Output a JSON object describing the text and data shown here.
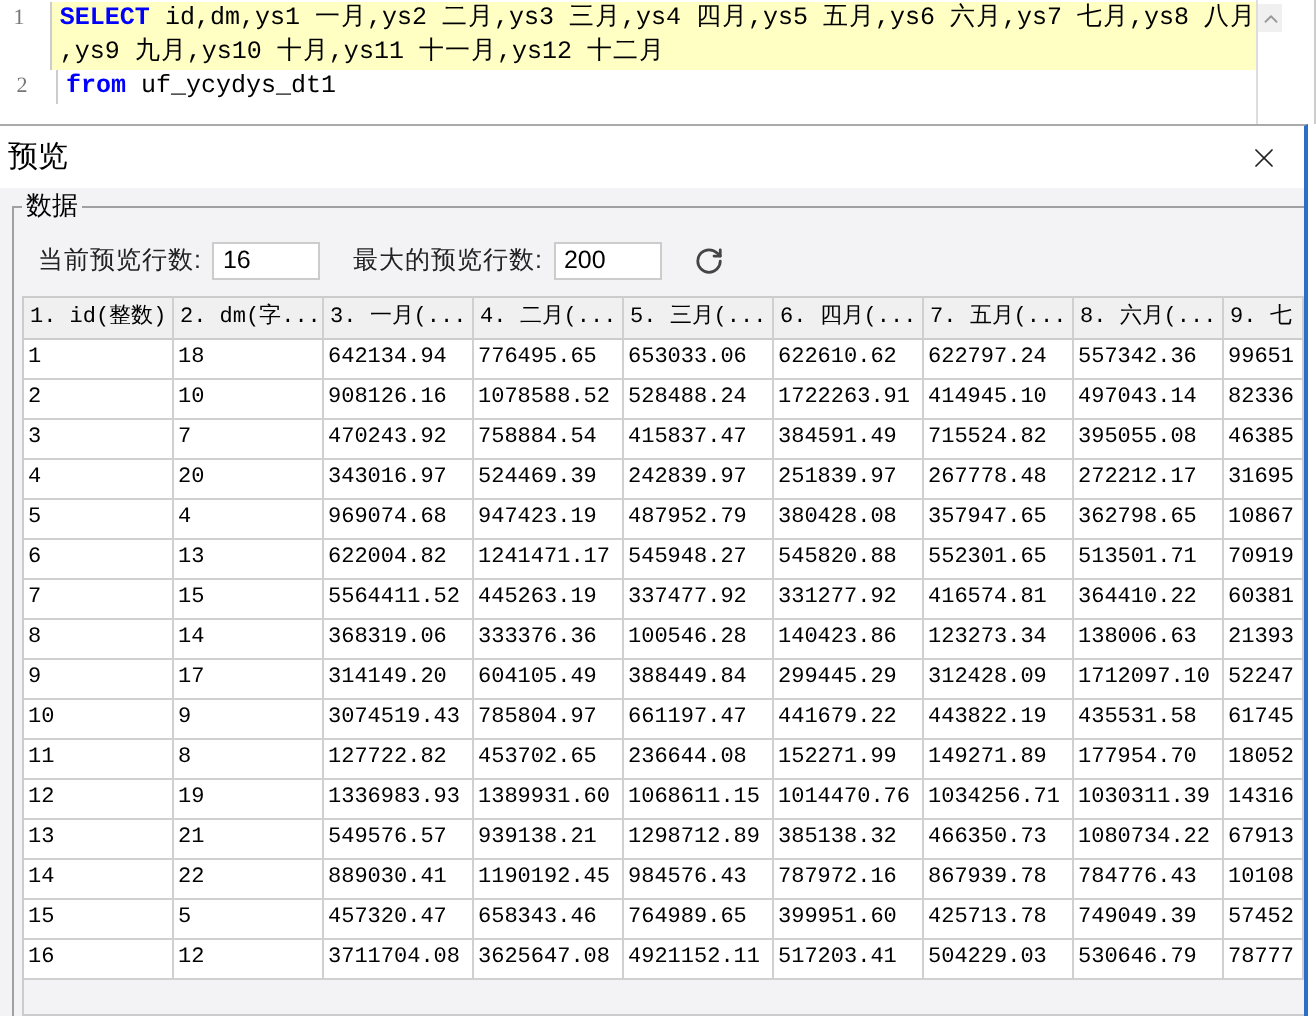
{
  "editor": {
    "lines": [
      {
        "number": "1",
        "highlighted": true,
        "rows": [
          [
            {
              "kind": "keyword",
              "text": "SELECT"
            },
            {
              "kind": "plain",
              "text": " id,dm,ys1 一月,ys2 二月,ys3 三月,ys4 四月,ys5 五月,ys6 六月,ys7 七月,ys8 八月"
            }
          ],
          [
            {
              "kind": "plain",
              "text": ",ys9 九月,ys10 十月,ys11 十一月,ys12 十二月"
            }
          ]
        ]
      },
      {
        "number": "2",
        "highlighted": false,
        "rows": [
          [
            {
              "kind": "keyword",
              "text": "from"
            },
            {
              "kind": "plain",
              "text": " uf_ycydys_dt1"
            }
          ]
        ]
      }
    ]
  },
  "dialog": {
    "title": "预览",
    "group_label": "数据",
    "current_rows": {
      "label": "当前预览行数:",
      "value": "16"
    },
    "max_rows": {
      "label": "最大的预览行数:",
      "value": "200"
    },
    "table": {
      "columns": [
        "1. id(整数)",
        "2. dm(字...",
        "3. 一月(...",
        "4. 二月(...",
        "5. 三月(...",
        "6. 四月(...",
        "7. 五月(...",
        "8. 六月(...",
        "9. 七"
      ],
      "rows": [
        [
          "1",
          "18",
          "642134.94",
          "776495.65",
          "653033.06",
          "622610.62",
          "622797.24",
          "557342.36",
          "99651"
        ],
        [
          "2",
          "10",
          "908126.16",
          "1078588.52",
          "528488.24",
          "1722263.91",
          "414945.10",
          "497043.14",
          "82336"
        ],
        [
          "3",
          "7",
          "470243.92",
          "758884.54",
          "415837.47",
          "384591.49",
          "715524.82",
          "395055.08",
          "46385"
        ],
        [
          "4",
          "20",
          "343016.97",
          "524469.39",
          "242839.97",
          "251839.97",
          "267778.48",
          "272212.17",
          "31695"
        ],
        [
          "5",
          "4",
          "969074.68",
          "947423.19",
          "487952.79",
          "380428.08",
          "357947.65",
          "362798.65",
          "10867"
        ],
        [
          "6",
          "13",
          "622004.82",
          "1241471.17",
          "545948.27",
          "545820.88",
          "552301.65",
          "513501.71",
          "70919"
        ],
        [
          "7",
          "15",
          "5564411.52",
          "445263.19",
          "337477.92",
          "331277.92",
          "416574.81",
          "364410.22",
          "60381"
        ],
        [
          "8",
          "14",
          "368319.06",
          "333376.36",
          "100546.28",
          "140423.86",
          "123273.34",
          "138006.63",
          "21393"
        ],
        [
          "9",
          "17",
          "314149.20",
          "604105.49",
          "388449.84",
          "299445.29",
          "312428.09",
          "1712097.10",
          "52247"
        ],
        [
          "10",
          "9",
          "3074519.43",
          "785804.97",
          "661197.47",
          "441679.22",
          "443822.19",
          "435531.58",
          "61745"
        ],
        [
          "11",
          "8",
          "127722.82",
          "453702.65",
          "236644.08",
          "152271.99",
          "149271.89",
          "177954.70",
          "18052"
        ],
        [
          "12",
          "19",
          "1336983.93",
          "1389931.60",
          "1068611.15",
          "1014470.76",
          "1034256.71",
          "1030311.39",
          "14316"
        ],
        [
          "13",
          "21",
          "549576.57",
          "939138.21",
          "1298712.89",
          "385138.32",
          "466350.73",
          "1080734.22",
          "67913"
        ],
        [
          "14",
          "22",
          "889030.41",
          "1190192.45",
          "984576.43",
          "787972.16",
          "867939.78",
          "784776.43",
          "10108"
        ],
        [
          "15",
          "5",
          "457320.47",
          "658343.46",
          "764989.65",
          "399951.60",
          "425713.78",
          "749049.39",
          "57452"
        ],
        [
          "16",
          "12",
          "3711704.08",
          "3625647.08",
          "4921152.11",
          "517203.41",
          "504229.03",
          "530646.79",
          "78777"
        ]
      ]
    }
  }
}
